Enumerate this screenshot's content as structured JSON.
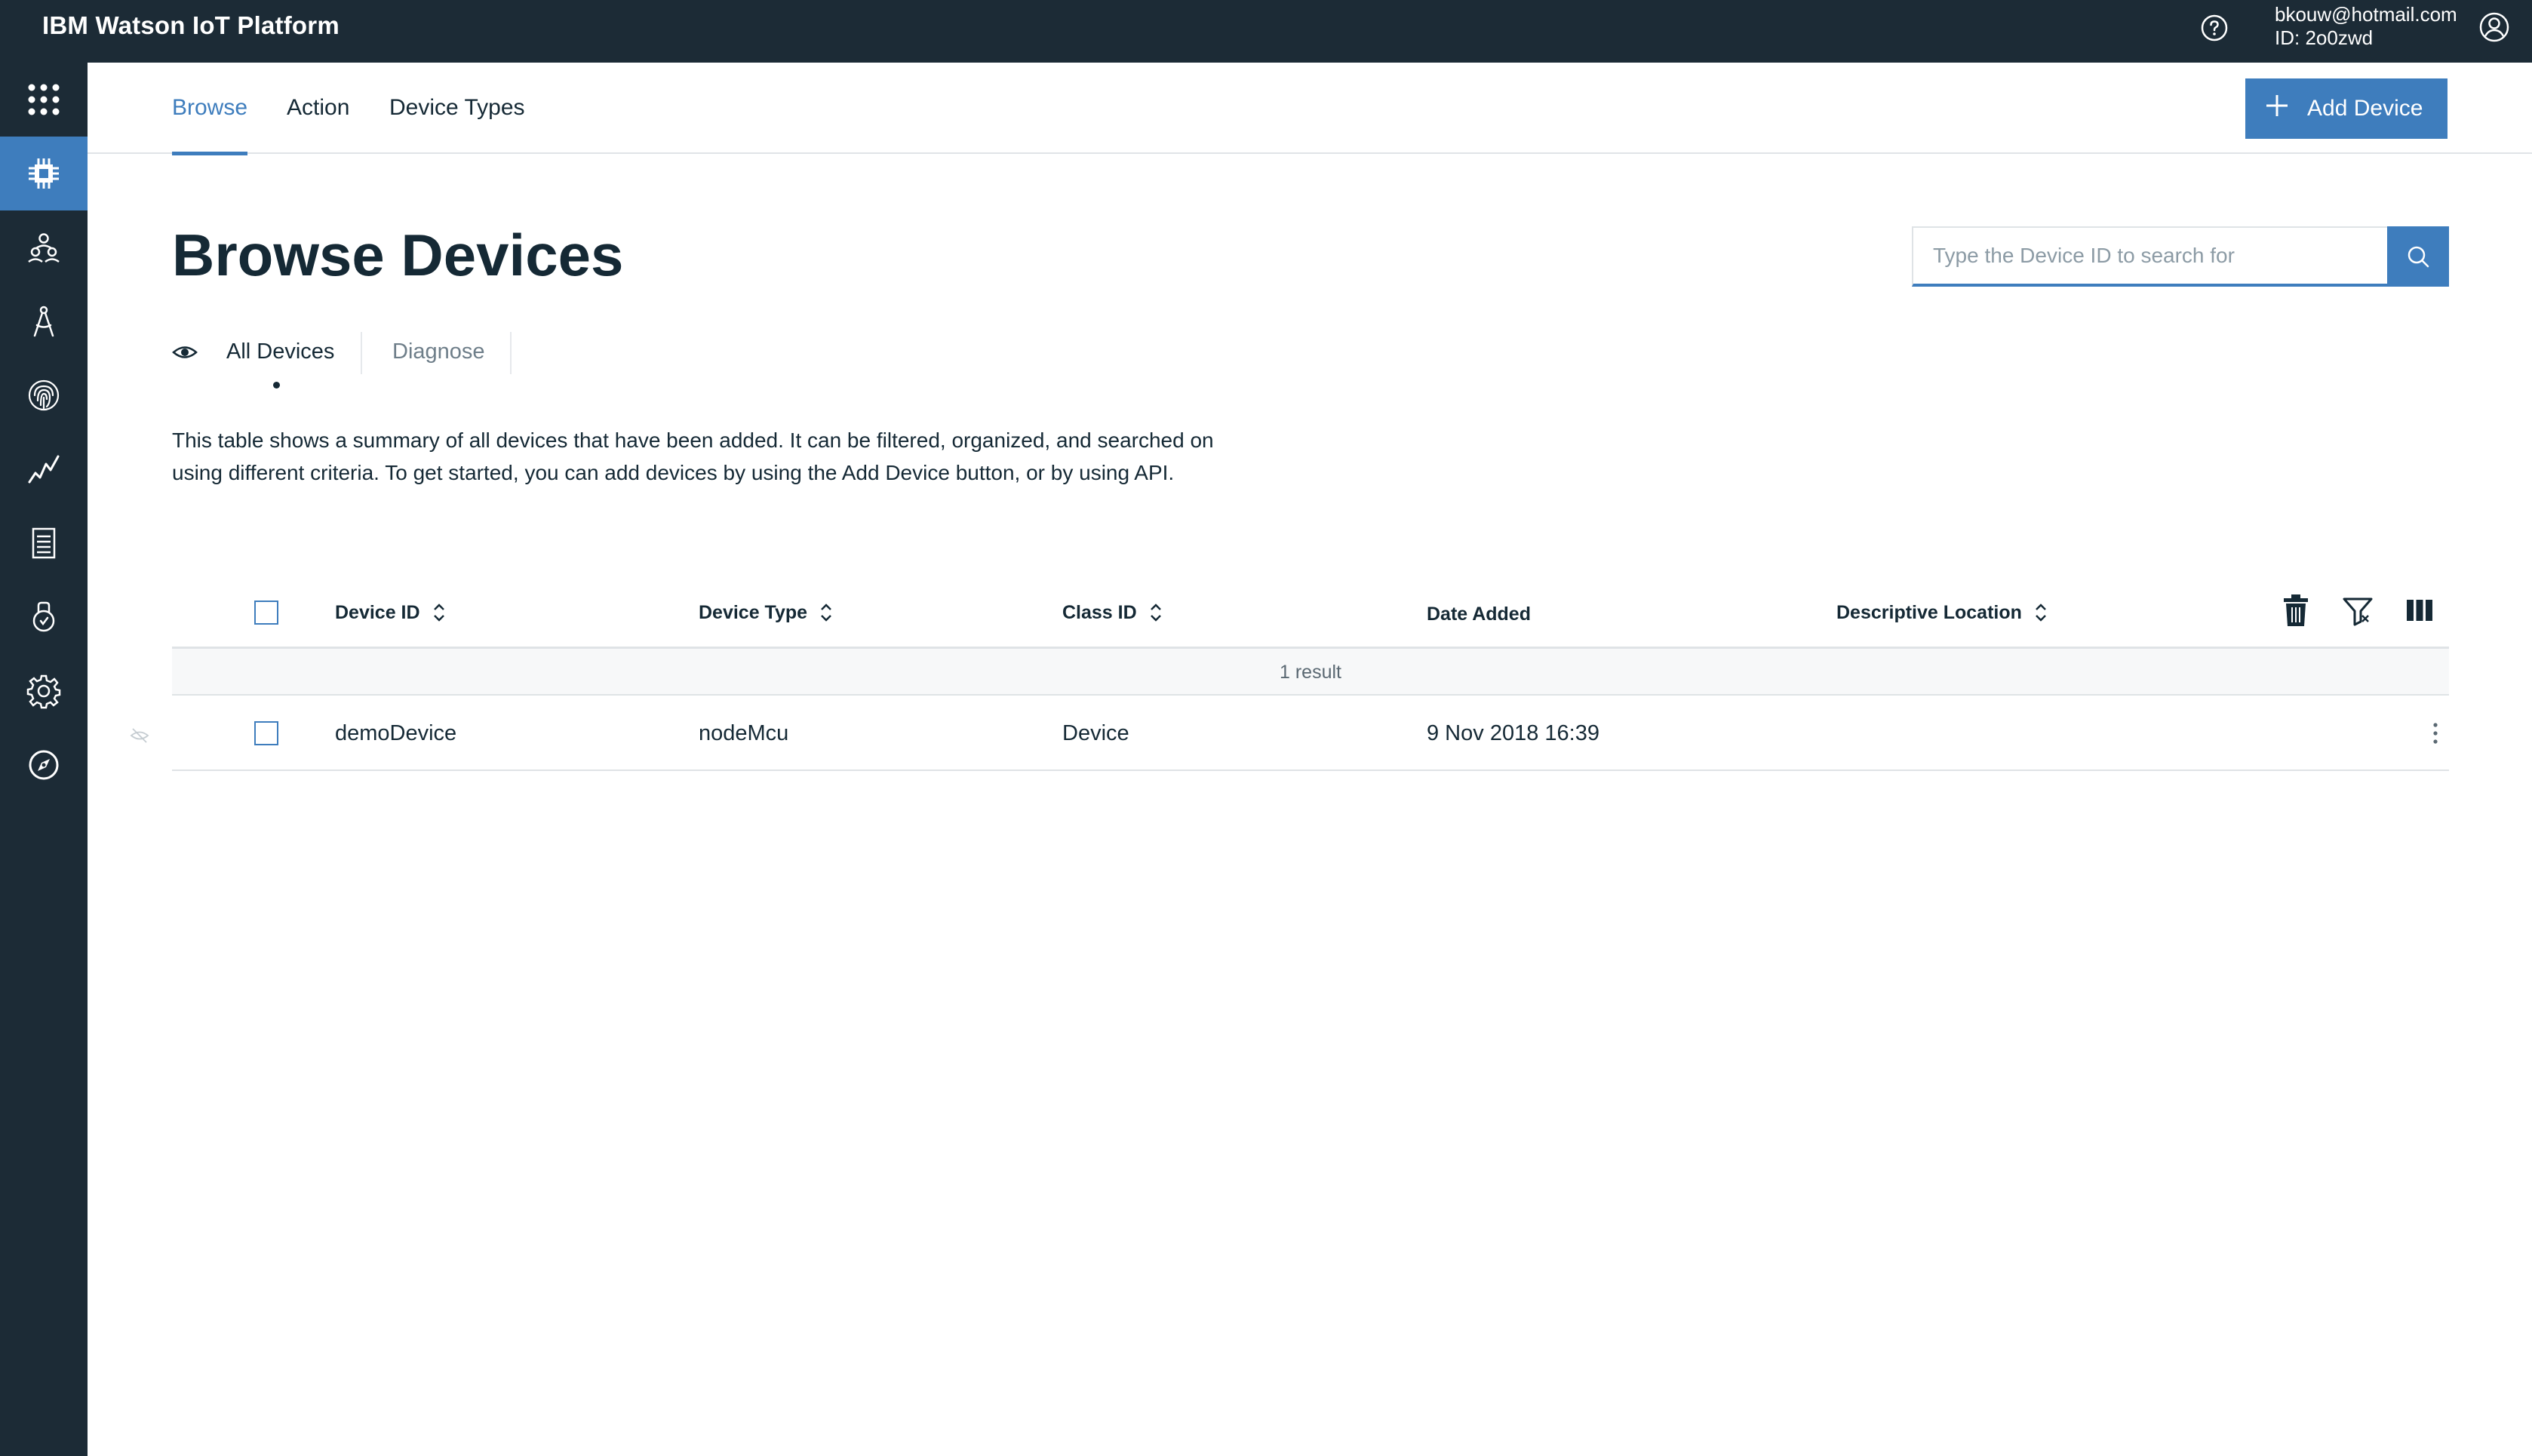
{
  "header": {
    "brand": "IBM Watson IoT Platform",
    "account_email": "bkouw@hotmail.com",
    "account_id": "ID: 2o0zwd",
    "icons": [
      "help-icon",
      "user-avatar-icon"
    ]
  },
  "sidebar": {
    "items": [
      {
        "name": "apps-grid-icon",
        "active": false
      },
      {
        "name": "devices-chip-icon",
        "active": true
      },
      {
        "name": "members-icon",
        "active": false
      },
      {
        "name": "rules-compass-icon",
        "active": false
      },
      {
        "name": "security-fingerprint-icon",
        "active": false
      },
      {
        "name": "usage-chart-icon",
        "active": false
      },
      {
        "name": "logs-document-icon",
        "active": false
      },
      {
        "name": "apps-key-icon",
        "active": false
      },
      {
        "name": "settings-gear-icon",
        "active": false
      },
      {
        "name": "explore-compass-icon",
        "active": false
      }
    ]
  },
  "tabs": {
    "browse": "Browse",
    "action": "Action",
    "device_types": "Device Types"
  },
  "add_device_label": "Add Device",
  "page_title": "Browse Devices",
  "search": {
    "placeholder": "Type the Device ID to search for"
  },
  "sub_tabs": {
    "all_devices": "All Devices",
    "diagnose": "Diagnose"
  },
  "description_line1": "This table shows a summary of all devices that have been added. It can be filtered, organized, and searched on",
  "description_line2": "using different criteria. To get started, you can add devices by using the Add Device button, or by using API.",
  "table": {
    "columns": {
      "device_id": "Device ID",
      "device_type": "Device Type",
      "class_id": "Class ID",
      "date_added": "Date Added",
      "descriptive_location": "Descriptive Location"
    },
    "result_count": "1 result",
    "rows": [
      {
        "device_id": "demoDevice",
        "device_type": "nodeMcu",
        "class_id": "Device",
        "date_added": "9 Nov 2018 16:39",
        "descriptive_location": ""
      }
    ]
  },
  "colors": {
    "header_bg": "#1c2b36",
    "accent": "#3e7dbd",
    "text": "#152935"
  }
}
